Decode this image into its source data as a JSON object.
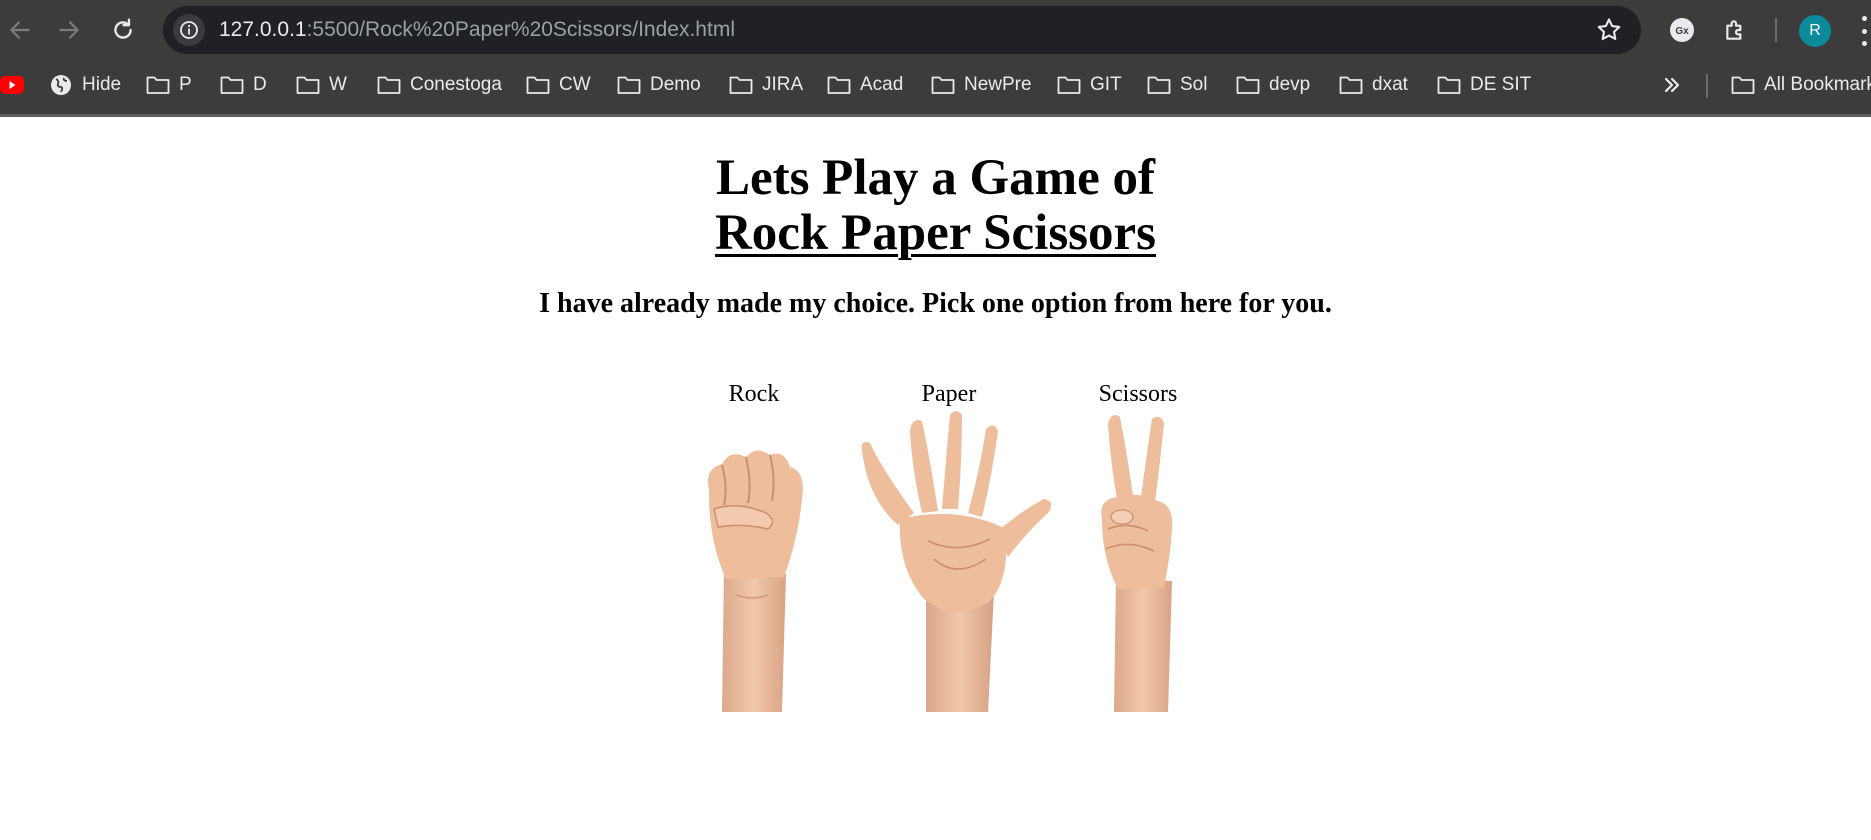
{
  "browser": {
    "url_host": "127.0.0.1",
    "url_rest": ":5500/Rock%20Paper%20Scissors/Index.html",
    "avatar_initial": "R",
    "bookmarks": [
      "Hide",
      "P",
      "D",
      "W",
      "Conestoga",
      "CW",
      "Demo",
      "JIRA",
      "Acad",
      "NewPre",
      "GIT",
      "Sol",
      "devp",
      "dxat",
      "DE SIT"
    ],
    "all_bookmarks_label": "All Bookmarks"
  },
  "page": {
    "title_line1": "Lets Play a Game of",
    "title_line2": "Rock Paper Scissors",
    "subtitle": "I have already made my choice. Pick one option from here for you.",
    "choices": [
      {
        "label": "Rock",
        "icon": "fist-hand-icon"
      },
      {
        "label": "Paper",
        "icon": "open-hand-icon"
      },
      {
        "label": "Scissors",
        "icon": "peace-sign-hand-icon"
      }
    ]
  },
  "colors": {
    "chrome_bg": "#3c3c3c",
    "omnibox_bg": "#202124",
    "avatar_bg": "#0b8a9c",
    "skin": "#e9bd9e"
  }
}
